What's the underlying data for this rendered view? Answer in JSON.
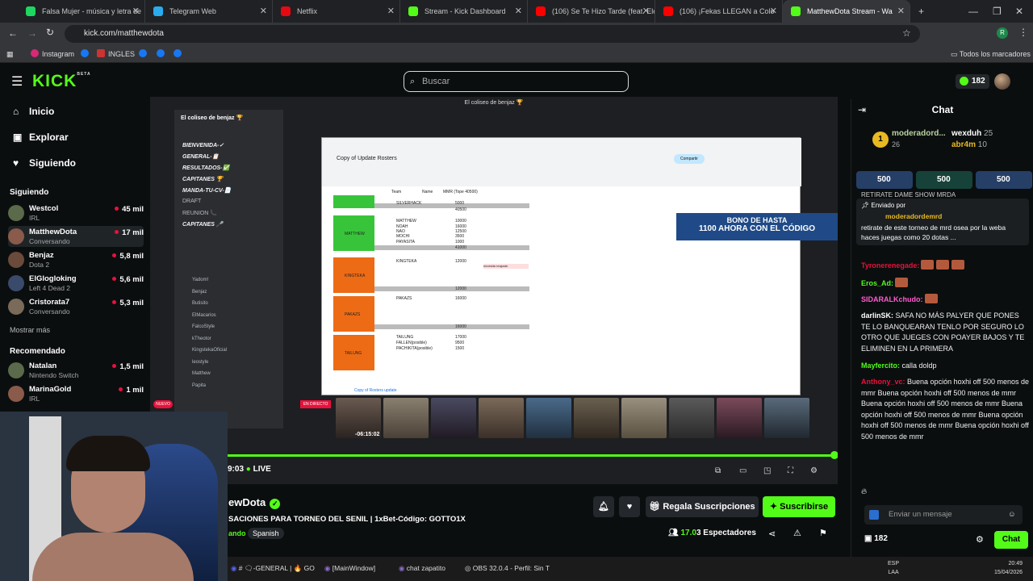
{
  "browser": {
    "tabs": [
      {
        "title": "Falsa Mujer - música y letra de",
        "color": "#1ed760"
      },
      {
        "title": "Telegram Web",
        "color": "#2aabee"
      },
      {
        "title": "Netflix",
        "color": "#e50914"
      },
      {
        "title": "Stream - Kick Dashboard",
        "color": "#53fc18"
      },
      {
        "title": "(106) Se Te Hizo Tarde (feat. Ele",
        "color": "#ff0000"
      },
      {
        "title": "(106) ¡Fekas LLEGAN a Colo",
        "color": "#ff0000"
      },
      {
        "title": "MatthewDota Stream - Wa",
        "color": "#53fc18"
      }
    ],
    "url": "kick.com/matthewdota",
    "bookmarks": [
      "Instagram",
      "INGLES"
    ],
    "all_bookmarks": "Todos los marcadores"
  },
  "kick": {
    "logo": "KICK",
    "logo_badge": "BETA",
    "search_placeholder": "Buscar",
    "kicks_count": "182",
    "nav": [
      {
        "label": "Inicio",
        "icon": "⌂"
      },
      {
        "label": "Explorar",
        "icon": "▣"
      },
      {
        "label": "Siguiendo",
        "icon": "♥"
      }
    ],
    "following_title": "Siguiendo",
    "following": [
      {
        "name": "Westcol",
        "category": "IRL",
        "viewers": "45 mil"
      },
      {
        "name": "MatthewDota",
        "category": "Conversando",
        "viewers": "17 mil"
      },
      {
        "name": "Benjaz",
        "category": "Dota 2",
        "viewers": "5,8 mil"
      },
      {
        "name": "ElGlogloking",
        "category": "Left 4 Dead 2",
        "viewers": "5,6 mil"
      },
      {
        "name": "Cristorata7",
        "category": "Conversando",
        "viewers": "5,3 mil"
      }
    ],
    "show_more": "Mostrar más",
    "recommended_title": "Recomendado",
    "recommended": [
      {
        "name": "Natalan",
        "category": "Nintendo Switch",
        "viewers": "1,5 mil"
      },
      {
        "name": "MarinaGold",
        "category": "IRL",
        "viewers": "1 mil"
      }
    ]
  },
  "video": {
    "discord_title": "El coliseo de benjaz 🏆",
    "server_name": "El coliseo de benjaz 🏆",
    "channels": [
      "BIENVENIDA-✓",
      "GENERAL-📋",
      "RESULTADOS-✅",
      "CAPITANES 🏆",
      "MANDA-TU-CV-📄",
      "DRAFT",
      "REUNION 📞",
      "CAPITANES 🎤"
    ],
    "voice_users": [
      "Yadom!",
      "Benjaz",
      "Butisito",
      "ElMacarios",
      "FalcoStyle",
      "kTheotor",
      "KingstekaOficial",
      "leostyle",
      "Matthew",
      "Papita"
    ],
    "live_tag": "EN DIRECTO",
    "sheet_title": "Copy of Update Rosters",
    "sheet_tab": "Copy of Rosters update",
    "sheet_headers": [
      "Team",
      "Name",
      "MMR (Tope 40500)"
    ],
    "rows": [
      {
        "name": "SILVERHACK",
        "mmr": "5000"
      },
      {
        "name": "",
        "mmr": "40500"
      },
      {
        "name": "MATTHEW",
        "mmr": "10000"
      },
      {
        "name": "NOAH",
        "mmr": "16000"
      },
      {
        "name": "NAO",
        "mmr": "12500"
      },
      {
        "name": "MOCHI",
        "mmr": "3500"
      },
      {
        "name": "PAYASITA",
        "mmr": "1000"
      },
      {
        "name": "",
        "mmr": "41000"
      },
      {
        "name": "KINGTEKA",
        "mmr": "12000"
      },
      {
        "name": "",
        "mmr": "12000"
      },
      {
        "name": "PAKAZS",
        "mmr": "16000"
      },
      {
        "name": "",
        "mmr": "16000"
      },
      {
        "name": "TAILUNG",
        "mmr": "17000"
      },
      {
        "name": "FALLEN(posible)",
        "mmr": "9500"
      },
      {
        "name": "PACHIKITA(posible)",
        "mmr": "1500"
      }
    ],
    "teams": [
      "MATTHEW",
      "KINGTEKA",
      "PAKAZS",
      "TAILUNG"
    ],
    "note": "necesita reajuste",
    "promo_line1": "BONO DE HASTA",
    "promo_line2": "1100 AHORA CON EL CÓDIGO",
    "thumb_time": "-06:15:02",
    "elapsed": "9:03",
    "live": "LIVE",
    "progress": 1.0
  },
  "stream": {
    "channel": "ewDota",
    "title": "SACIONES PARA TORNEO DEL SENIL | 1xBet-Código: GOTTO1X",
    "category": "ando",
    "language": "Spanish",
    "gift_label": "Regala Suscripciones",
    "subscribe_label": "Suscribirse",
    "viewers": "17.0",
    "viewers_suffix": "3 Espectadores"
  },
  "taskbar": {
    "items": [
      "# 🗨-GENERAL | 🔥 GO",
      "[MainWindow]",
      "chat zapatito",
      "OBS 32.0.4 - Perfil: Sin T"
    ],
    "lang": "ESP",
    "lang2": "LAA",
    "time": "20:49",
    "date": "15/04/2026"
  },
  "chat": {
    "title": "Chat",
    "top_gifter": {
      "name": "moderadord...",
      "count": "26"
    },
    "gifters": [
      {
        "name": "wexduh",
        "count": "25"
      },
      {
        "name": "abr4m",
        "count": "10"
      }
    ],
    "chips": [
      "500",
      "500",
      "500"
    ],
    "pinned_top": "RETIRATE DAME SHOW MRDA",
    "pinned_by": "Enviado por",
    "pinned_user": "moderadordemrd",
    "pinned_text": "retirate de este torneo de mrd osea por la weba haces juegas como 20 dotas ...",
    "messages": [
      {
        "user": "Tyronerenegade:",
        "text": "",
        "color": "#e9113c"
      },
      {
        "user": "Eros_Ad:",
        "text": "",
        "color": "#53fc18"
      },
      {
        "user": "SIDARALKchudo:",
        "text": "",
        "color": "#ff5bd1"
      },
      {
        "user": "darlinSK:",
        "text": "SAFA NO MÁS PALYER QUE PONES TE LO BANQUEARAN TENLO POR SEGURO LO OTRO QUE JUEGES CON POAYER BAJOS Y TE ELIMINEN EN LA PRIMERA",
        "color": "#ffffff"
      },
      {
        "user": "Mayfercito:",
        "text": "calla doldp",
        "color": "#53fc18"
      },
      {
        "user": "Anthony_vc:",
        "text": "Buena opción hoxhi off 500 menos de mmr",
        "color": "#e9113c"
      }
    ],
    "spam": "Buena opción hoxhi off 500 menos de mmr",
    "input_placeholder": "Enviar un mensaje",
    "kicks": "182",
    "send_label": "Chat"
  }
}
